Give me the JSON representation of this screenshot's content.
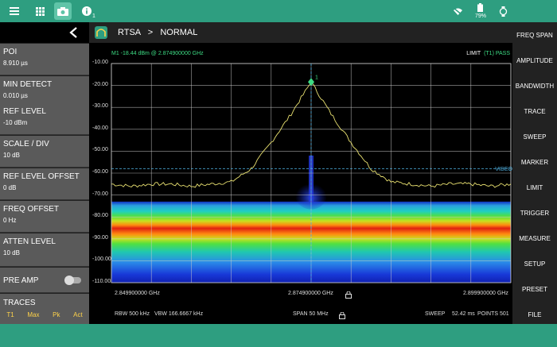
{
  "statusbar": {
    "icons": [
      "menu-icon",
      "apps-grid-icon",
      "camera-icon",
      "info-icon"
    ],
    "info_badge": "1",
    "battery_percent": "79%",
    "right_icons": [
      "no-signal-icon",
      "battery-icon",
      "rotate-icon"
    ]
  },
  "left_panel": {
    "params": [
      {
        "label": "POI",
        "value": "8.910 µs"
      },
      {
        "label": "MIN DETECT",
        "value": "0.010 µs"
      },
      {
        "label": "REF LEVEL",
        "value": "-10 dBm"
      },
      {
        "label": "SCALE / DIV",
        "value": "10 dB"
      },
      {
        "label": "REF LEVEL OFFSET",
        "value": "0 dB"
      },
      {
        "label": "FREQ OFFSET",
        "value": "0 Hz"
      },
      {
        "label": "ATTEN LEVEL",
        "value": "10 dB"
      }
    ],
    "preamp_label": "PRE AMP",
    "preamp_on": false,
    "traces_label": "TRACES",
    "traces_row": [
      "T1",
      "Max",
      "Pk",
      "Act"
    ]
  },
  "topbar": {
    "mode": "RTSA",
    "separator": ">",
    "submode": "NORMAL"
  },
  "right_menu": [
    "FREQ SPAN",
    "AMPLITUDE",
    "BANDWIDTH",
    "TRACE",
    "SWEEP",
    "MARKER",
    "LIMIT",
    "TRIGGER",
    "MEASURE",
    "SETUP",
    "PRESET",
    "FILE"
  ],
  "plot": {
    "marker_readout": "M1   -18.44  dBm @ 2.874900000 GHz",
    "limit_label": "LIMIT",
    "limit_status": "(T1) PASS",
    "marker_id": "1",
    "video_label": "VIDEO",
    "start_freq": "2.849900000 GHz",
    "center_freq": "2.874900000 GHz",
    "stop_freq": "2.899900000 GHz",
    "rbw": "RBW 500 kHz",
    "vbw": "VBW 166.6667 kHz",
    "span": "SPAN 50 MHz",
    "sweep_label": "SWEEP",
    "sweep_time": "52.42 ms",
    "points": "POINTS 501",
    "colors": {
      "trace": "#e8e070",
      "marker": "#3ddc84",
      "grid": "#cccccc",
      "video_line": "#4fb0e0"
    }
  },
  "chart_data": {
    "type": "line",
    "title": "",
    "xlabel": "",
    "ylabel": "",
    "yticks": [
      "-10.00",
      "-20.00",
      "-30.00",
      "-40.00",
      "-50.00",
      "-60.00",
      "-70.00",
      "-80.00",
      "-90.00",
      "-100.00",
      "-110.00"
    ],
    "ylim": [
      -110,
      -10
    ],
    "xlim_ghz": [
      2.8499,
      2.8999
    ],
    "series": [
      {
        "x_ghz": [
          2.8499,
          2.8524,
          2.8549,
          2.8574,
          2.8599,
          2.8624,
          2.8649,
          2.8674,
          2.8699,
          2.8724,
          2.8749,
          2.8774,
          2.8799,
          2.8824,
          2.8849,
          2.8874,
          2.8899,
          2.8924,
          2.8949,
          2.8974,
          2.8999
        ],
        "y_dbm": [
          -65,
          -66,
          -65,
          -65,
          -66,
          -65,
          -64,
          -58,
          -46,
          -33,
          -18.44,
          -33,
          -46,
          -58,
          -64,
          -65,
          -66,
          -65,
          -65,
          -66,
          -65
        ]
      }
    ],
    "marker": {
      "x_ghz": 2.8749,
      "y_dbm": -18.44
    },
    "video_trigger_dbm": -58
  }
}
